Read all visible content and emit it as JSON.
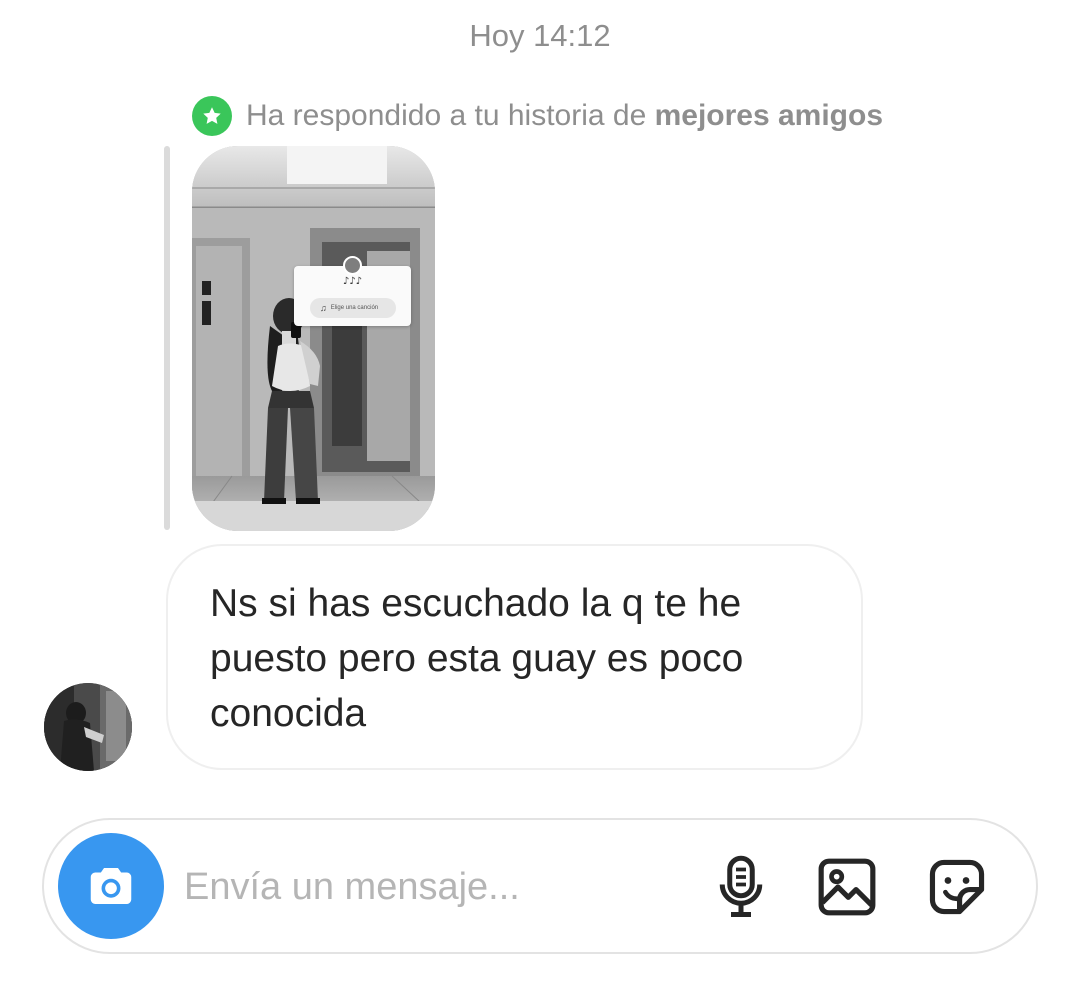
{
  "header": {
    "timestamp": "Hoy 14:12"
  },
  "story_reply": {
    "note_prefix": "Ha respondido a tu historia de ",
    "note_emphasis": "mejores amigos",
    "badge_color": "#3ac65a",
    "sticker": {
      "notes": "♪♪♪",
      "button_label": "Elige una canción",
      "button_icon": "music-note-icon"
    }
  },
  "message": {
    "text": "Ns si has escuchado la q te he puesto pero esta guay es poco conocida"
  },
  "composer": {
    "placeholder": "Envía un mensaje...",
    "accent_color": "#3897f0",
    "icons": [
      "camera-icon",
      "microphone-icon",
      "gallery-icon",
      "sticker-icon"
    ]
  }
}
